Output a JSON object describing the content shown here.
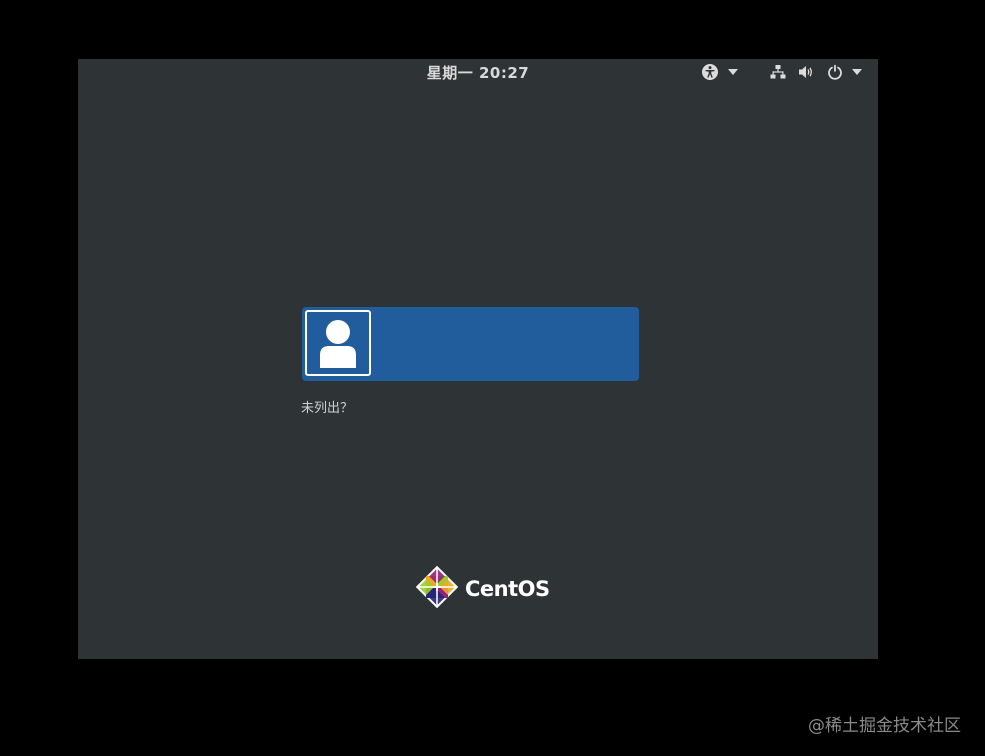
{
  "topbar": {
    "clock": "星期一 20:27",
    "icons": {
      "accessibility": "accessibility-icon",
      "network": "network-wired-icon",
      "volume": "volume-icon",
      "power": "power-icon",
      "dropdown": "triangle-down-icon"
    }
  },
  "user_list": {
    "users": [
      {
        "name": "",
        "avatar": "user-avatar-icon"
      }
    ],
    "not_listed_label": "未列出？"
  },
  "branding": {
    "logo_text": "CentOS"
  },
  "watermark": "@稀土掘金技术社区",
  "colors": {
    "background": "#2e3436",
    "outer": "#000000",
    "selection": "#215d9c",
    "text": "#d9d9d9"
  }
}
